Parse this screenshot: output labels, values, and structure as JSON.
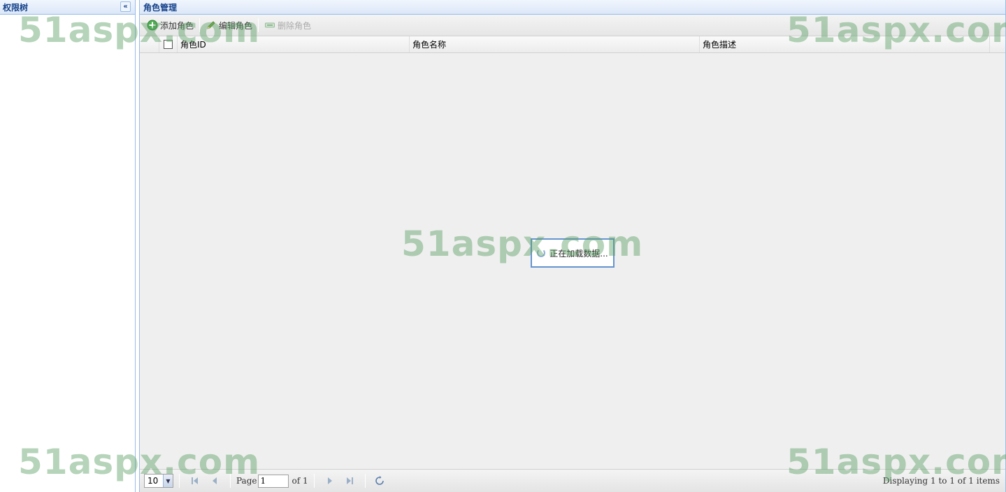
{
  "left_panel": {
    "title": "权限树",
    "collapse_glyph": "«"
  },
  "main_panel": {
    "title": "角色管理",
    "toolbar": {
      "add_label": "添加角色",
      "edit_label": "编辑角色",
      "delete_label": "删除角色"
    },
    "grid": {
      "columns": [
        "角色ID",
        "角色名称",
        "角色描述"
      ]
    },
    "loading_text": "正在加载数据...",
    "pager": {
      "page_size": "10",
      "page_label": "Page",
      "page_value": "1",
      "of_label": "of 1",
      "display_text": "Displaying 1 to 1 of 1 items"
    }
  },
  "watermark": "51aspx.com",
  "colors": {
    "border": "#99bbe8",
    "header_text": "#15428b",
    "watermark": "#5aa064"
  },
  "icons": {
    "add": "add-icon",
    "edit": "pencil-icon",
    "delete": "delete-icon",
    "first": "first-page-icon",
    "prev": "prev-page-icon",
    "next": "next-page-icon",
    "last": "last-page-icon",
    "refresh": "refresh-icon",
    "spinner": "loading-spinner-icon"
  }
}
